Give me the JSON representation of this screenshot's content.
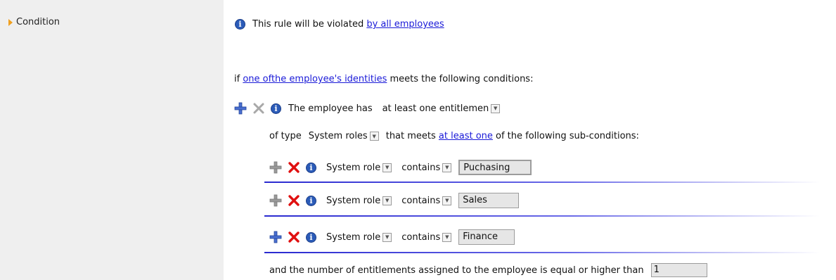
{
  "sidebar": {
    "condition_label": "Condition"
  },
  "info_line": {
    "prefix": "This rule will be violated ",
    "link": "by all employees"
  },
  "if_line": {
    "prefix": "if ",
    "link": "one ofthe employee's identities",
    "suffix": " meets the following conditions:"
  },
  "employee_rule": {
    "text": "The employee has",
    "quantity_value": "at least one entitlemen"
  },
  "type_line": {
    "of_type": "of type",
    "type_value": "System roles",
    "meets_prefix": "that meets ",
    "meets_link": "at least one",
    "meets_suffix": " of the following sub-conditions:"
  },
  "subconditions": [
    {
      "field": "System role",
      "operator": "contains",
      "value": "Puchasing"
    },
    {
      "field": "System role",
      "operator": "contains",
      "value": "Sales"
    },
    {
      "field": "System role",
      "operator": "contains",
      "value": "Finance"
    }
  ],
  "threshold_line": {
    "text": "and the number of entitlements assigned to the employee is equal or higher than",
    "value": "1"
  },
  "colors": {
    "link": "#1a1ad8",
    "accent_blue": "#2a2ad0",
    "remove_red": "#e01010",
    "info_blue": "#2b5bb8"
  },
  "icons": [
    "arrow-right-icon",
    "info-icon",
    "plus-icon",
    "remove-icon",
    "dropdown-icon"
  ]
}
